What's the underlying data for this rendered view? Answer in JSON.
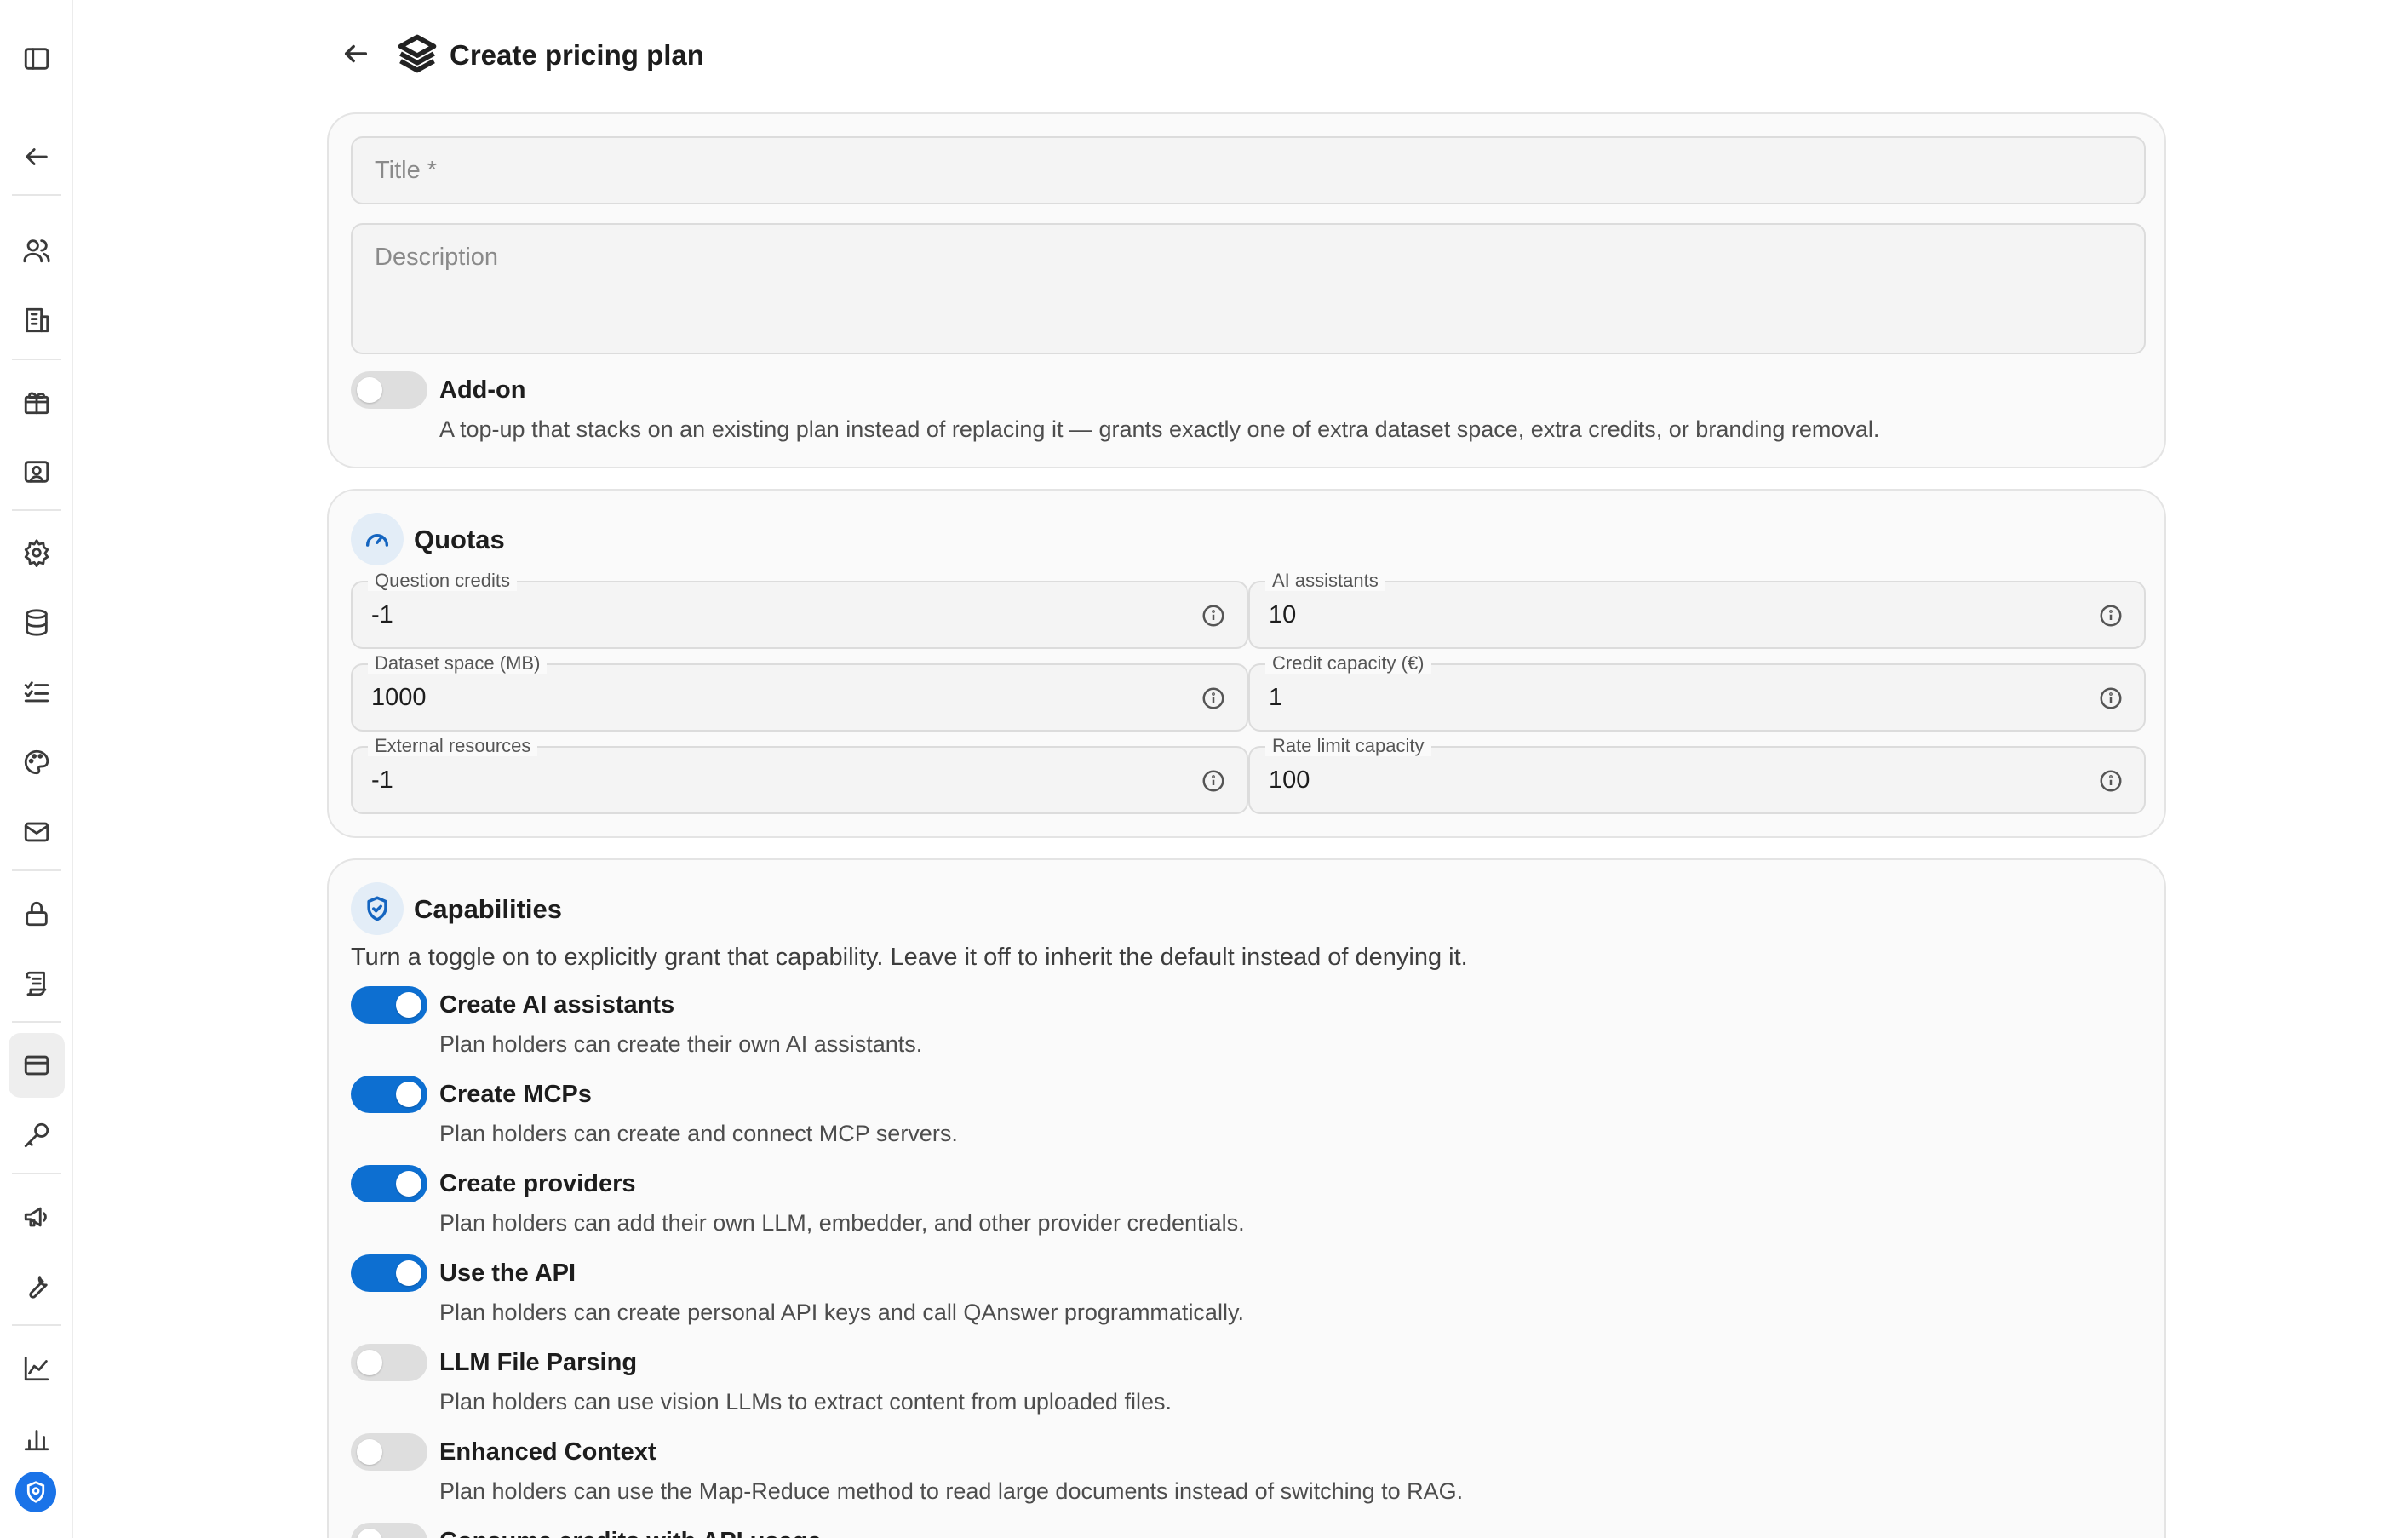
{
  "header": {
    "title": "Create pricing plan"
  },
  "general": {
    "title_placeholder": "Title *",
    "description_placeholder": "Description",
    "addon": {
      "label": "Add-on",
      "description": "A top-up that stacks on an existing plan instead of replacing it — grants exactly one of extra dataset space, extra credits, or branding removal.",
      "enabled": false
    }
  },
  "quotas": {
    "title": "Quotas",
    "fields": [
      {
        "label": "Question credits",
        "value": "-1"
      },
      {
        "label": "AI assistants",
        "value": "10"
      },
      {
        "label": "Dataset space (MB)",
        "value": "1000"
      },
      {
        "label": "Credit capacity (€)",
        "value": "1"
      },
      {
        "label": "External resources",
        "value": "-1"
      },
      {
        "label": "Rate limit capacity",
        "value": "100"
      }
    ]
  },
  "capabilities": {
    "title": "Capabilities",
    "intro": "Turn a toggle on to explicitly grant that capability. Leave it off to inherit the default instead of denying it.",
    "items": [
      {
        "label": "Create AI assistants",
        "description": "Plan holders can create their own AI assistants.",
        "enabled": true
      },
      {
        "label": "Create MCPs",
        "description": "Plan holders can create and connect MCP servers.",
        "enabled": true
      },
      {
        "label": "Create providers",
        "description": "Plan holders can add their own LLM, embedder, and other provider credentials.",
        "enabled": true
      },
      {
        "label": "Use the API",
        "description": "Plan holders can create personal API keys and call QAnswer programmatically.",
        "enabled": true
      },
      {
        "label": "LLM File Parsing",
        "description": "Plan holders can use vision LLMs to extract content from uploaded files.",
        "enabled": false
      },
      {
        "label": "Enhanced Context",
        "description": "Plan holders can use the Map-Reduce method to read large documents instead of switching to RAG.",
        "enabled": false
      },
      {
        "label": "Consume credits with API usage",
        "description": "",
        "enabled": false
      }
    ]
  },
  "sidebar": {
    "icons": [
      "sidebar-toggle-icon",
      "arrow-left-icon",
      "users-icon",
      "organizations-icon",
      "gift-icon",
      "assistant-icon",
      "gear-icon",
      "database-icon",
      "checklist-icon",
      "palette-icon",
      "mail-icon",
      "lock-icon",
      "scroll-icon",
      "credit-card-icon",
      "key-icon",
      "megaphone-icon",
      "wrench-icon",
      "line-chart-icon",
      "bar-chart-icon",
      "admin-shield-icon"
    ],
    "active": "credit-card-icon"
  },
  "colors": {
    "accent": "#0d6fd1",
    "toggle_off": "#dedede",
    "card_bg": "#fafafa",
    "badge": "#1a73e8"
  }
}
